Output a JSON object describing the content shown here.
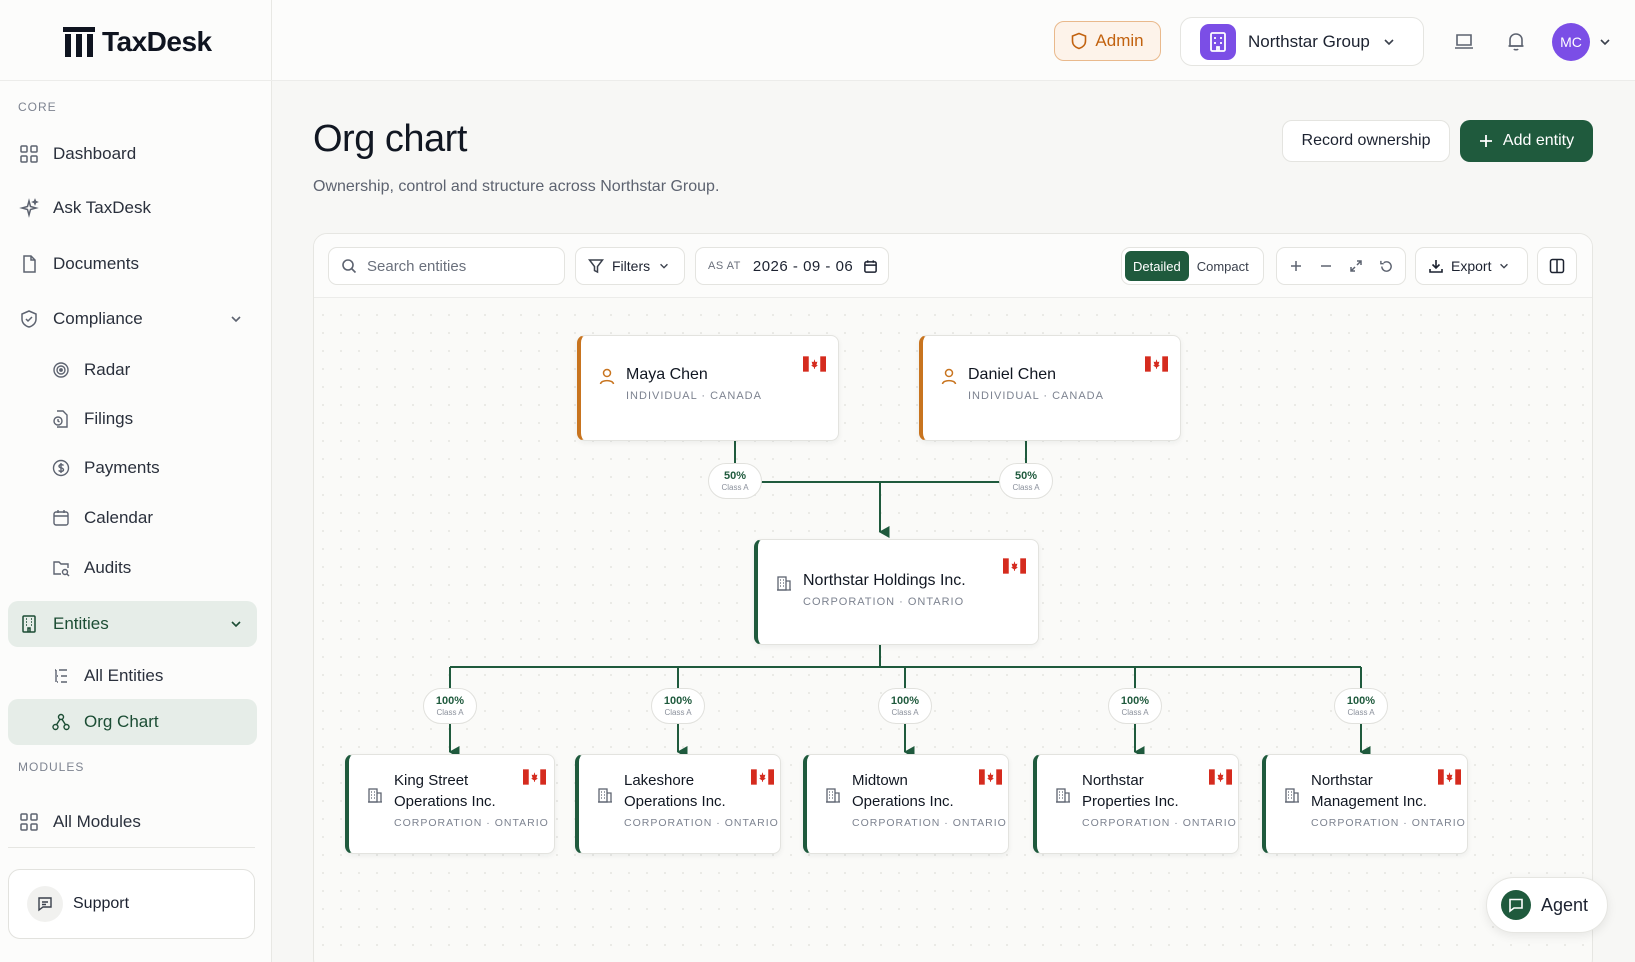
{
  "app": {
    "name": "TaxDesk"
  },
  "sidebar": {
    "sections": {
      "core": "CORE",
      "modules": "MODULES"
    },
    "items": {
      "dashboard": "Dashboard",
      "ask": "Ask TaxDesk",
      "documents": "Documents",
      "compliance": "Compliance",
      "radar": "Radar",
      "filings": "Filings",
      "payments": "Payments",
      "calendar": "Calendar",
      "audits": "Audits",
      "entities": "Entities",
      "all_entities": "All Entities",
      "org_chart": "Org Chart",
      "all_modules": "All Modules"
    },
    "support": "Support"
  },
  "header": {
    "admin": "Admin",
    "org": "Northstar Group",
    "avatar": "MC"
  },
  "page": {
    "title": "Org chart",
    "subtitle": "Ownership, control and structure across Northstar Group.",
    "record_ownership": "Record ownership",
    "add_entity": "Add entity"
  },
  "toolbar": {
    "search_placeholder": "Search entities",
    "filters": "Filters",
    "as_at_label": "AS AT",
    "as_at_date": "2026 - 09 - 06",
    "view_detailed": "Detailed",
    "view_compact": "Compact",
    "export": "Export"
  },
  "org": {
    "owners": [
      {
        "name": "Maya Chen",
        "meta": "INDIVIDUAL · CANADA",
        "stake": "50%",
        "class": "Class A"
      },
      {
        "name": "Daniel Chen",
        "meta": "INDIVIDUAL · CANADA",
        "stake": "50%",
        "class": "Class A"
      }
    ],
    "holding": {
      "name": "Northstar Holdings Inc.",
      "meta": "CORPORATION · ONTARIO"
    },
    "subsidiaries": [
      {
        "name_line1": "King Street",
        "name_line2": "Operations Inc.",
        "meta": "CORPORATION · ONTARIO",
        "stake": "100%",
        "class": "Class A"
      },
      {
        "name_line1": "Lakeshore",
        "name_line2": "Operations Inc.",
        "meta": "CORPORATION · ONTARIO",
        "stake": "100%",
        "class": "Class A"
      },
      {
        "name_line1": "Midtown",
        "name_line2": "Operations Inc.",
        "meta": "CORPORATION · ONTARIO",
        "stake": "100%",
        "class": "Class A"
      },
      {
        "name_line1": "Northstar",
        "name_line2": "Properties Inc.",
        "meta": "CORPORATION · ONTARIO",
        "stake": "100%",
        "class": "Class A"
      },
      {
        "name_line1": "Northstar",
        "name_line2": "Management Inc.",
        "meta": "CORPORATION · ONTARIO",
        "stake": "100%",
        "class": "Class A"
      }
    ]
  },
  "agent": {
    "label": "Agent"
  },
  "colors": {
    "brand": "#1f5a3d",
    "owner_accent": "#c8741f",
    "org_badge": "#7b4ee6"
  }
}
